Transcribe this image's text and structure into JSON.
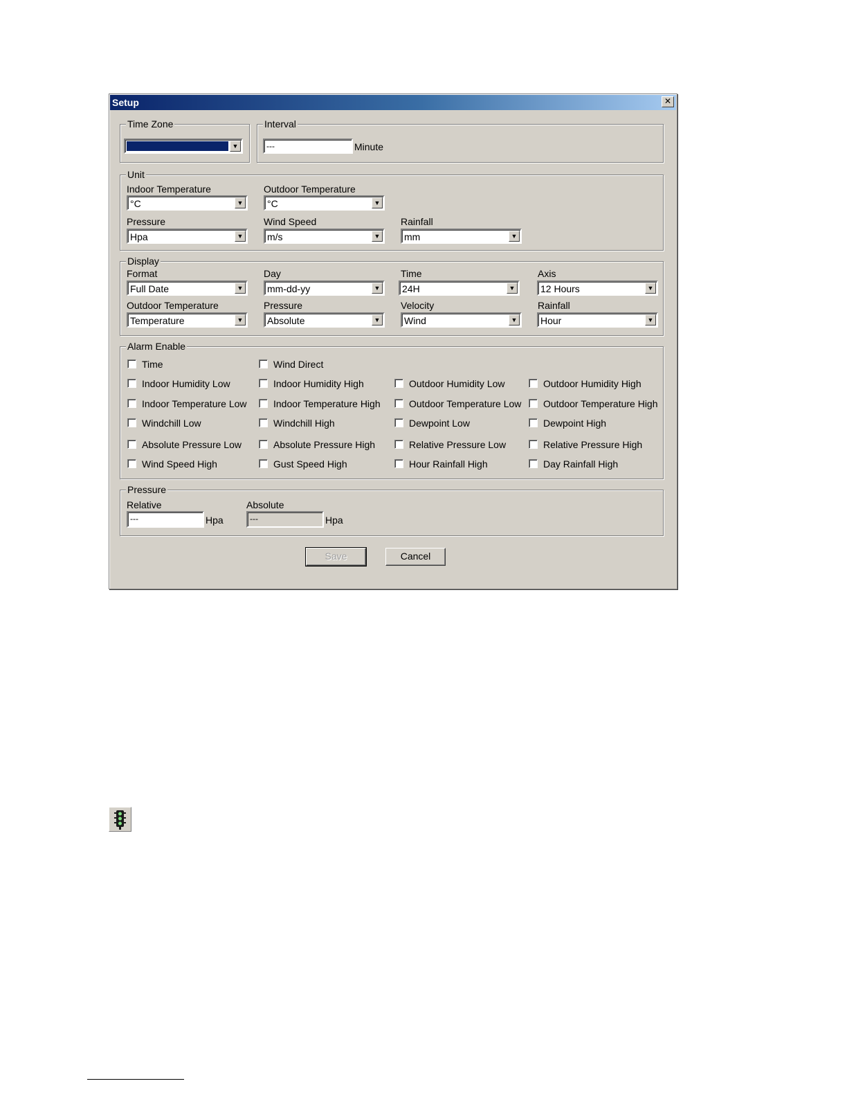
{
  "window": {
    "title": "Setup",
    "close_glyph": "✕"
  },
  "time_zone": {
    "legend": "Time Zone",
    "value": ""
  },
  "interval": {
    "legend": "Interval",
    "value": "---",
    "unit": "Minute"
  },
  "unit": {
    "legend": "Unit",
    "indoor_temperature": {
      "label": "Indoor Temperature",
      "value": "°C"
    },
    "outdoor_temperature": {
      "label": "Outdoor Temperature",
      "value": "°C"
    },
    "pressure": {
      "label": "Pressure",
      "value": "Hpa"
    },
    "wind_speed": {
      "label": "Wind Speed",
      "value": "m/s"
    },
    "rainfall": {
      "label": "Rainfall",
      "value": "mm"
    }
  },
  "display": {
    "legend": "Display",
    "format": {
      "label": "Format",
      "value": "Full Date"
    },
    "day": {
      "label": "Day",
      "value": "mm-dd-yy"
    },
    "time": {
      "label": "Time",
      "value": "24H"
    },
    "axis": {
      "label": "Axis",
      "value": "12 Hours"
    },
    "outdoor_temperature": {
      "label": "Outdoor Temperature",
      "value": "Temperature"
    },
    "pressure": {
      "label": "Pressure",
      "value": "Absolute"
    },
    "velocity": {
      "label": "Velocity",
      "value": "Wind"
    },
    "rainfall": {
      "label": "Rainfall",
      "value": "Hour"
    }
  },
  "alarm": {
    "legend": "Alarm Enable",
    "items": [
      "Time",
      "Wind Direct",
      "Indoor Humidity Low",
      "Indoor Humidity High",
      "Outdoor Humidity Low",
      "Outdoor Humidity High",
      "Indoor Temperature Low",
      "Indoor Temperature High",
      "Outdoor Temperature Low",
      "Outdoor Temperature High",
      "Windchill Low",
      "Windchill High",
      "Dewpoint Low",
      "Dewpoint High",
      "Absolute Pressure Low",
      "Absolute Pressure High",
      "Relative Pressure Low",
      "Relative Pressure High",
      "Wind Speed High",
      "Gust Speed High",
      "Hour Rainfall High",
      "Day Rainfall High"
    ]
  },
  "pressure": {
    "legend": "Pressure",
    "relative": {
      "label": "Relative",
      "value": "---",
      "unit": "Hpa"
    },
    "absolute": {
      "label": "Absolute",
      "value": "---",
      "unit": "Hpa"
    }
  },
  "buttons": {
    "save": "Save",
    "cancel": "Cancel"
  },
  "icons": {
    "dropdown": "▼",
    "traffic_light": "traffic-light-icon"
  }
}
